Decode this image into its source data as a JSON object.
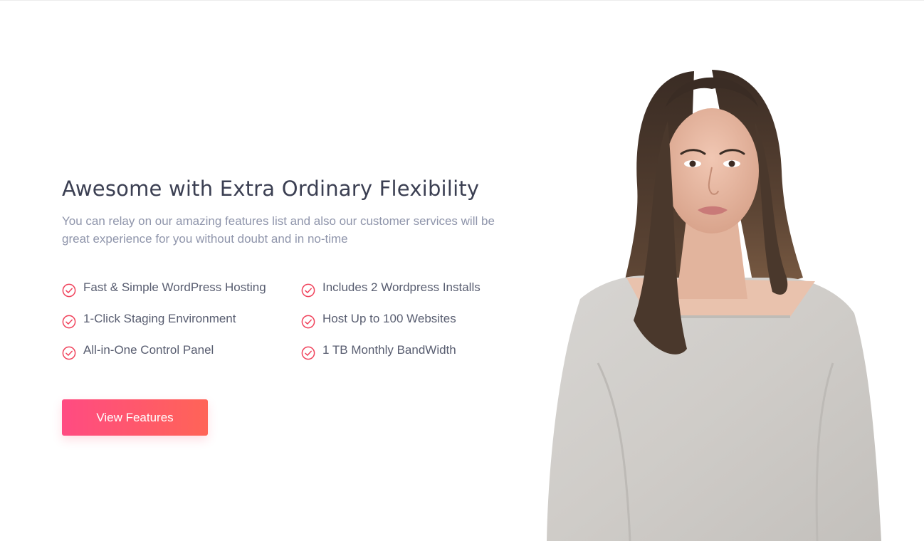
{
  "section": {
    "headline": "Awesome with Extra Ordinary Flexibility",
    "subtext": "You can relay on our amazing features list and also our customer services will be great experience for you without doubt and in no-time",
    "features": [
      "Fast & Simple WordPress Hosting",
      "Includes 2 Wordpress Installs",
      "1-Click Staging Environment",
      "Host Up to 100 Websites",
      "All-in-One Control Panel",
      "1 TB Monthly BandWidth"
    ],
    "cta_label": "View Features"
  },
  "icons": {
    "feature_bullet": "check-circle-icon"
  },
  "colors": {
    "accent_start": "#ff4b82",
    "accent_end": "#ff6457",
    "check": "#f0435c",
    "headline": "#3b3f52",
    "subtext": "#8f95ab",
    "feature_text": "#585d70"
  }
}
